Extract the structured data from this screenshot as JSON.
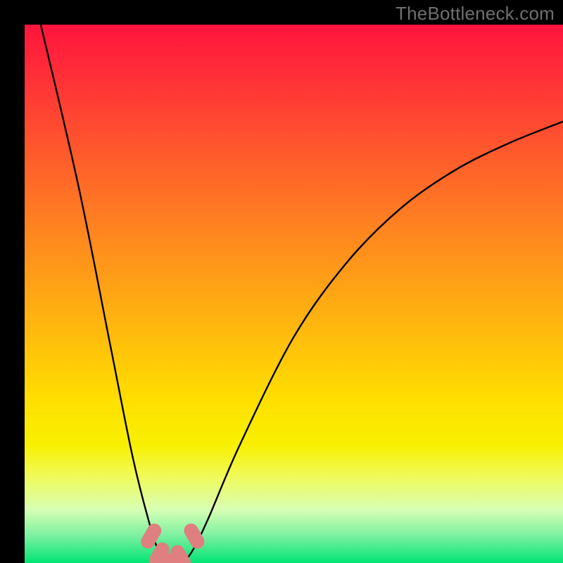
{
  "watermark": "TheBottleneck.com",
  "chart_data": {
    "type": "line",
    "title": "",
    "xlabel": "",
    "ylabel": "",
    "xlim": [
      0,
      100
    ],
    "ylim": [
      0,
      100
    ],
    "background_gradient": {
      "direction": "top-to-bottom",
      "stops": [
        {
          "pct": 0,
          "color": "#ff143c"
        },
        {
          "pct": 24,
          "color": "#ff5a2c"
        },
        {
          "pct": 55,
          "color": "#ffb40f"
        },
        {
          "pct": 78,
          "color": "#f8f000"
        },
        {
          "pct": 100,
          "color": "#00e474"
        }
      ]
    },
    "series": [
      {
        "name": "bottleneck-curve",
        "color": "#000000",
        "x": [
          3,
          10,
          16,
          20,
          23,
          25,
          27,
          29,
          31,
          34,
          40,
          50,
          60,
          70,
          80,
          90,
          100
        ],
        "y": [
          100,
          70,
          40,
          20,
          8,
          2,
          0,
          0,
          2,
          8,
          22,
          42,
          56,
          66,
          73,
          78,
          82
        ]
      }
    ],
    "markers": [
      {
        "x": 23.5,
        "y": 5,
        "color": "#e07f7f"
      },
      {
        "x": 25.0,
        "y": 1.5,
        "color": "#e07f7f"
      },
      {
        "x": 27.0,
        "y": 0.5,
        "color": "#e07f7f"
      },
      {
        "x": 29.0,
        "y": 1.0,
        "color": "#e07f7f"
      },
      {
        "x": 31.5,
        "y": 5,
        "color": "#e07f7f"
      }
    ],
    "grid": false,
    "legend": false
  }
}
